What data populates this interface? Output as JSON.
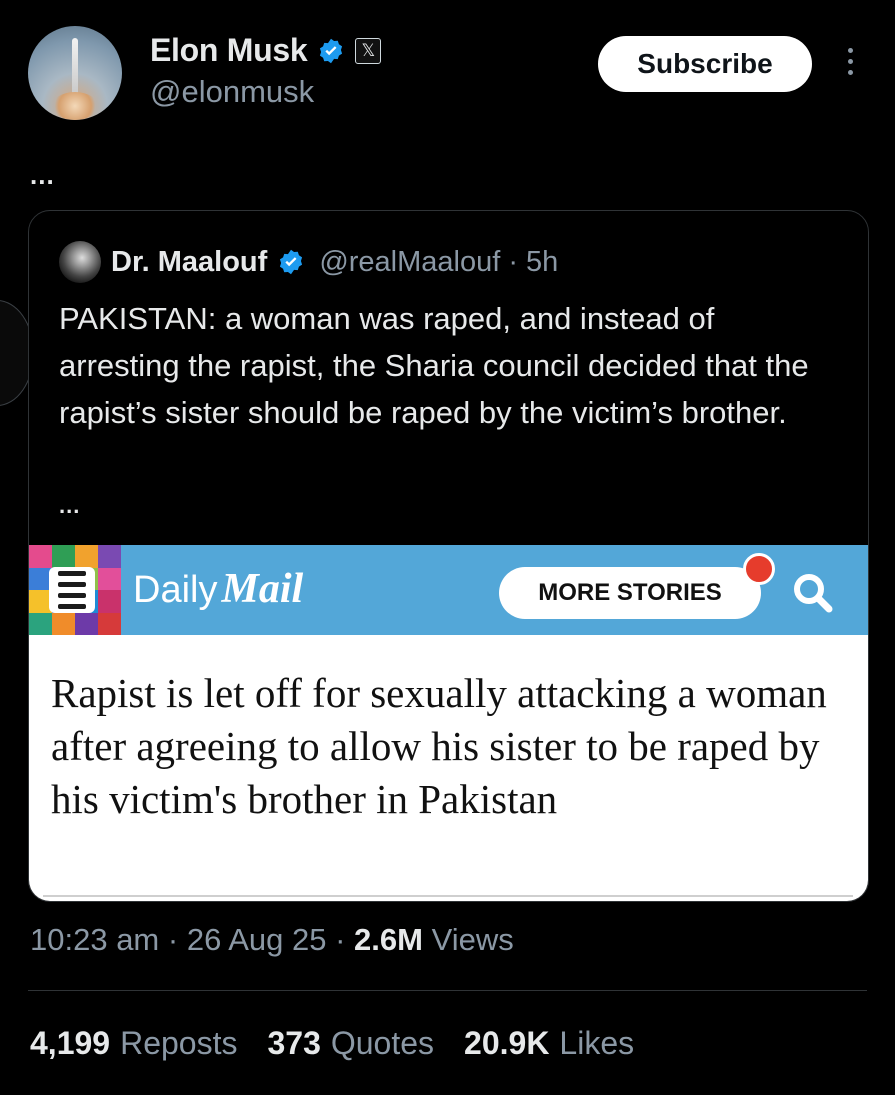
{
  "author": {
    "name": "Elon Musk",
    "handle": "@elonmusk",
    "badge_x": "𝕏"
  },
  "subscribe_label": "Subscribe",
  "tweet_ellipsis": "...",
  "quoted": {
    "name": "Dr. Maalouf",
    "handle_time": "@realMaalouf · 5h",
    "text": "PAKISTAN: a woman was raped, and instead of arresting the rapist, the Sharia council decided that the rapist’s sister should be raped by the victim’s brother.",
    "ellipsis": "..."
  },
  "dailymail": {
    "daily": "Daily",
    "mail": "Mail",
    "more_stories": "MORE STORIES",
    "headline": "Rapist is let off for sexually attacking a woman after agreeing to allow his sister to be raped by his victim's brother in Pakistan",
    "colors": {
      "bar": "#53a7d8",
      "mosaic": [
        "#e44b8d",
        "#2f9e55",
        "#f1a22d",
        "#7a4ab2",
        "#3b7ed8",
        "#d8342a",
        "#8fc04a",
        "#e24f9a",
        "#f5c12a",
        "#4a5fc4",
        "#1e8ad6",
        "#c9326b",
        "#2ba37e",
        "#f08c2a",
        "#6d3aa8",
        "#d63a3a"
      ]
    }
  },
  "meta": {
    "time": "10:23 am",
    "date": "26 Aug 25",
    "views_count": "2.6M",
    "views_label": "Views"
  },
  "stats": {
    "reposts_count": "4,199",
    "reposts_label": "Reposts",
    "quotes_count": "373",
    "quotes_label": "Quotes",
    "likes_count": "20.9K",
    "likes_label": "Likes"
  },
  "colors": {
    "background": "#000000",
    "verified": "#1d9bf0",
    "muted_text": "#8b98a5"
  }
}
